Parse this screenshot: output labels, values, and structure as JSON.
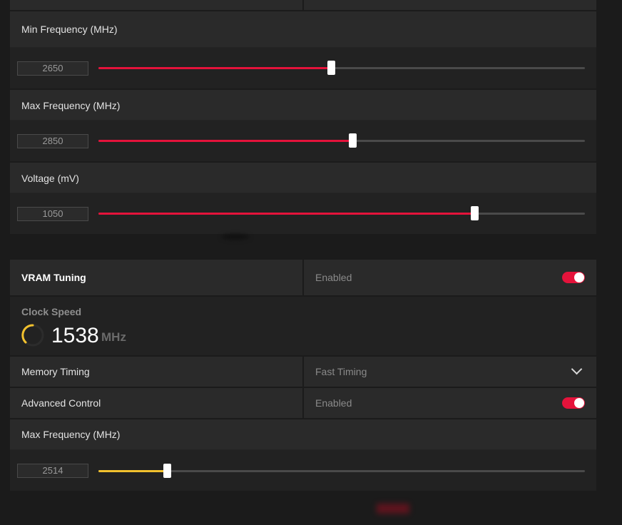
{
  "colors": {
    "accent_red": "#e4133b",
    "accent_yellow": "#f2c12e",
    "toggle_on": "#e4133b"
  },
  "gpu_tuning": {
    "min_frequency": {
      "label": "Min Frequency (MHz)",
      "value": "2650",
      "fraction": 0.48
    },
    "max_frequency": {
      "label": "Max Frequency (MHz)",
      "value": "2850",
      "fraction": 0.52
    },
    "voltage": {
      "label": "Voltage (mV)",
      "value": "1050",
      "fraction": 0.77
    }
  },
  "vram": {
    "title": "VRAM Tuning",
    "status": "Enabled",
    "toggle_on": true,
    "clock_speed_label": "Clock Speed",
    "clock_speed_value": "1538",
    "clock_speed_unit": "MHz",
    "memory_timing": {
      "label": "Memory Timing",
      "value": "Fast Timing"
    },
    "advanced_control": {
      "label": "Advanced Control",
      "status": "Enabled",
      "toggle_on": true
    },
    "max_frequency": {
      "label": "Max Frequency (MHz)",
      "value": "2514",
      "fraction": 0.14
    }
  }
}
